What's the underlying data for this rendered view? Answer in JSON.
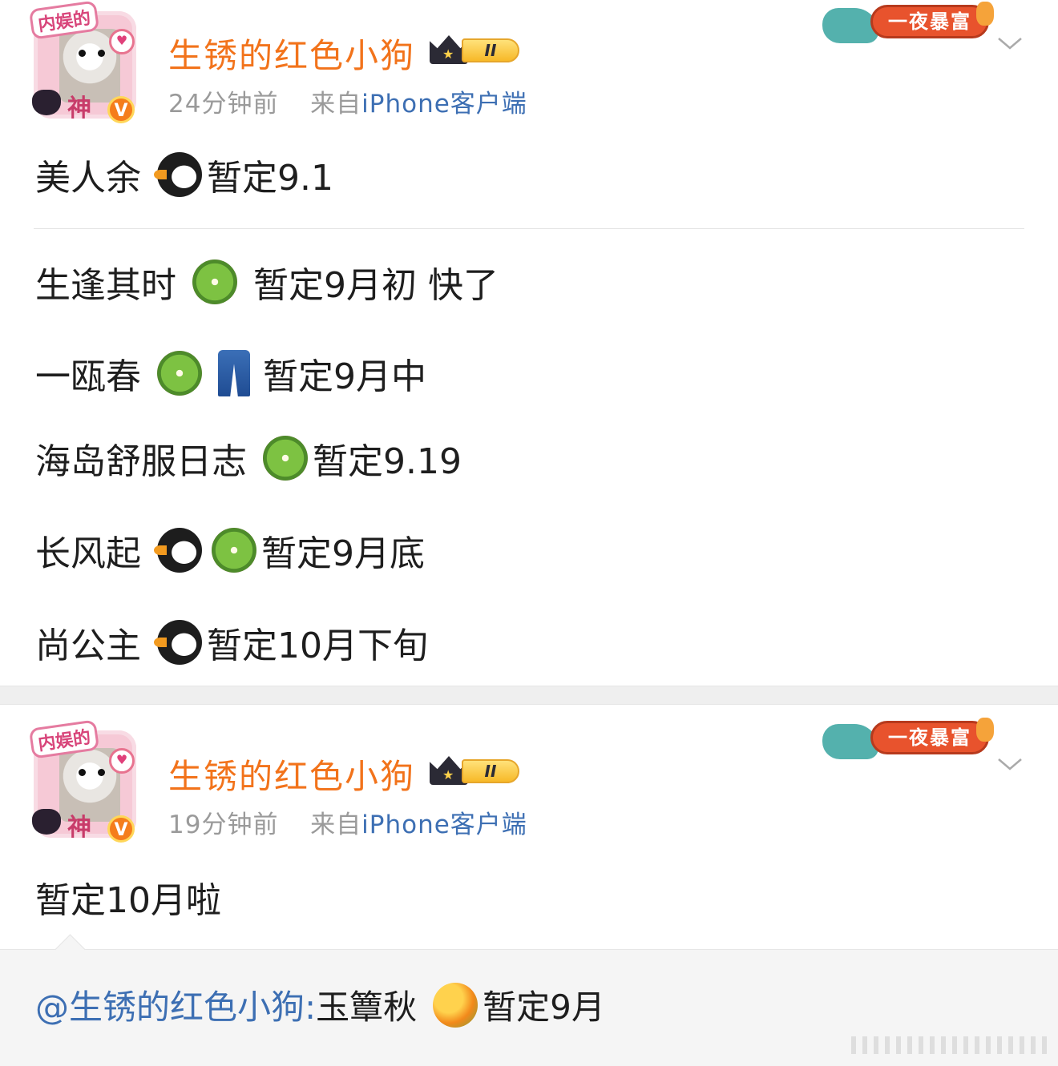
{
  "posts": [
    {
      "avatar": {
        "tag_text": "内娱的",
        "bottom_text": "神",
        "verified_badge": "V"
      },
      "username": "生锈的红色小狗",
      "member_level": "II",
      "time": "24分钟前",
      "from_prefix": "来自",
      "source": "iPhone客户端",
      "decor_banner": "一夜暴富",
      "lines": [
        {
          "pre": "美人余",
          "emojis": [
            "penguin-emoji"
          ],
          "post": "暂定9.1"
        },
        {
          "pre": "生逢其时",
          "emojis": [
            "kiwi-emoji"
          ],
          "post": "暂定9月初 快了"
        },
        {
          "pre": "一瓯春",
          "emojis": [
            "kiwi-emoji",
            "jeans-emoji"
          ],
          "post": "暂定9月中"
        },
        {
          "pre": "海岛舒服日志",
          "emojis": [
            "kiwi-emoji"
          ],
          "post": "暂定9.19"
        },
        {
          "pre": "长风起",
          "emojis": [
            "penguin-emoji",
            "kiwi-emoji"
          ],
          "post": "暂定9月底"
        },
        {
          "pre": "尚公主",
          "emojis": [
            "penguin-emoji"
          ],
          "post": "暂定10月下旬"
        }
      ]
    },
    {
      "avatar": {
        "tag_text": "内娱的",
        "bottom_text": "神",
        "verified_badge": "V"
      },
      "username": "生锈的红色小狗",
      "member_level": "II",
      "time": "19分钟前",
      "from_prefix": "来自",
      "source": "iPhone客户端",
      "decor_banner": "一夜暴富",
      "text": "暂定10月啦",
      "retweet": {
        "mention": "@生锈的红色小狗:",
        "pre": "玉簟秋",
        "emoji": "mango-emoji",
        "post": "暂定9月"
      }
    }
  ],
  "colors": {
    "username": "#f2731b",
    "source_link": "#3d6fb3",
    "meta_gray": "#9a9a9a",
    "banner_red": "#e8532d"
  }
}
